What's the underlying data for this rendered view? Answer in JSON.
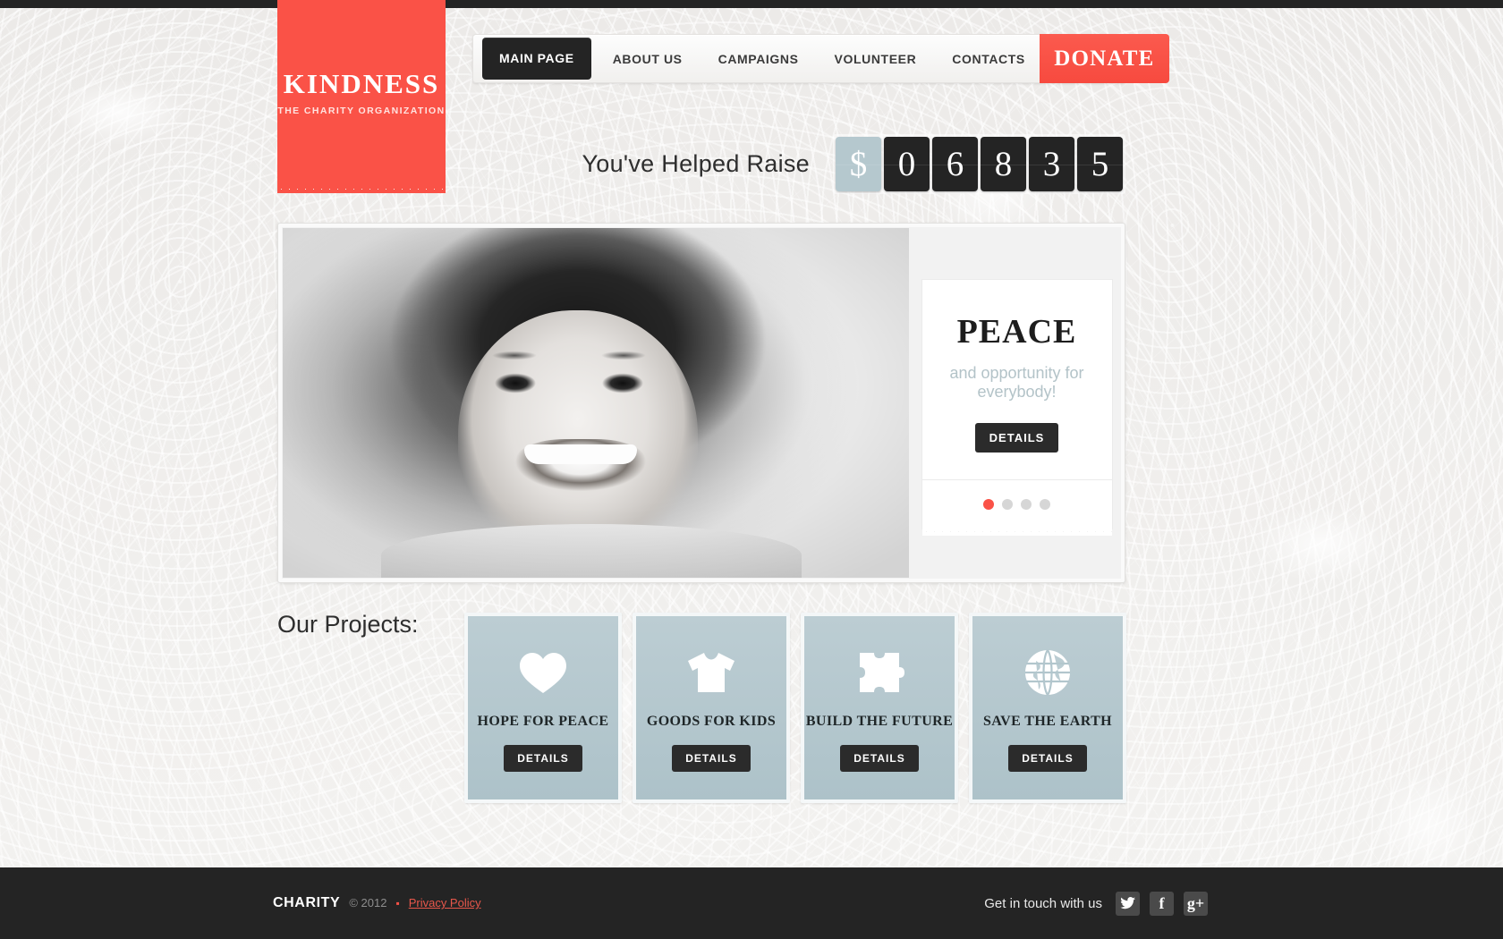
{
  "brand": {
    "name": "KINDNESS",
    "tagline": "THE CHARITY ORGANIZATION"
  },
  "nav": {
    "items": [
      {
        "label": "MAIN PAGE",
        "active": true
      },
      {
        "label": "ABOUT US",
        "active": false
      },
      {
        "label": "CAMPAIGNS",
        "active": false
      },
      {
        "label": "VOLUNTEER",
        "active": false
      },
      {
        "label": "CONTACTS",
        "active": false
      }
    ],
    "donate_label": "DONATE"
  },
  "counter": {
    "label": "You've Helped Raise",
    "currency": "$",
    "digits": [
      "0",
      "6",
      "8",
      "3",
      "5"
    ]
  },
  "slider": {
    "title": "PEACE",
    "subtitle": "and opportunity for everybody!",
    "details_label": "DETAILS",
    "dots": [
      {
        "active": true
      },
      {
        "active": false
      },
      {
        "active": false
      },
      {
        "active": false
      }
    ]
  },
  "projects": {
    "heading": "Our Projects:",
    "cards": [
      {
        "icon": "heart-icon",
        "title": "HOPE FOR PEACE",
        "details_label": "DETAILS"
      },
      {
        "icon": "tshirt-icon",
        "title": "GOODS FOR KIDS",
        "details_label": "DETAILS"
      },
      {
        "icon": "puzzle-icon",
        "title": "BUILD THE FUTURE",
        "details_label": "DETAILS"
      },
      {
        "icon": "globe-icon",
        "title": "SAVE THE EARTH",
        "details_label": "DETAILS"
      }
    ]
  },
  "footer": {
    "brand": "CHARITY",
    "copyright": "© 2012",
    "bullet": "▪",
    "privacy_label": "Privacy Policy",
    "social_label": "Get in touch with us",
    "social": [
      {
        "name": "twitter-icon",
        "glyph": "🐦"
      },
      {
        "name": "facebook-icon",
        "glyph": "f"
      },
      {
        "name": "googleplus-icon",
        "glyph": "g+"
      }
    ]
  },
  "colors": {
    "accent": "#fa5247",
    "dark": "#242424",
    "card": "#b5c8ce"
  }
}
